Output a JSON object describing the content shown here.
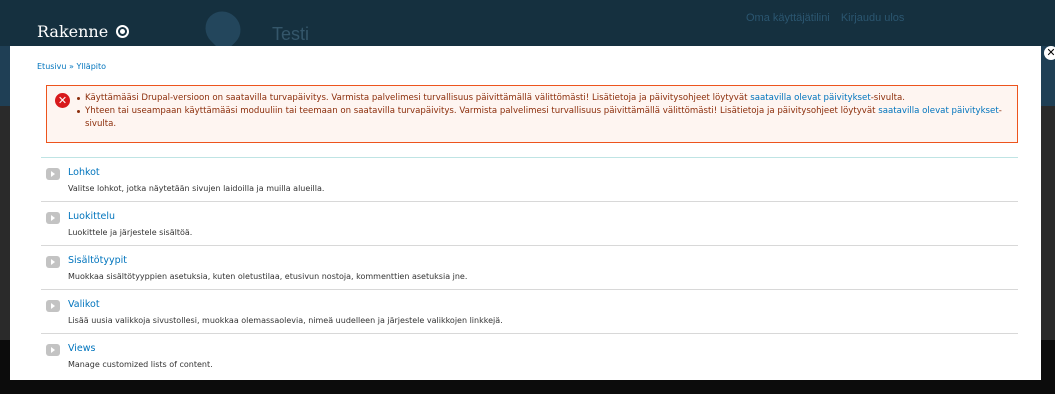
{
  "background": {
    "site_name": "Testi",
    "user_links": [
      "Oma käyttäjätilini",
      "Kirjaudu ulos"
    ]
  },
  "overlay": {
    "title": "Rakenne",
    "shortcut_icon": "add-shortcut-icon",
    "close_icon": "close-icon"
  },
  "breadcrumb": {
    "items": [
      "Etusivu",
      "Ylläpito"
    ],
    "separator": "»"
  },
  "messages": {
    "type": "error",
    "icon": "error-icon",
    "items": [
      {
        "text": "Käyttämääsi Drupal-versioon on saatavilla turvapäivitys. Varmista palvelimesi turvallisuus päivittämällä välittömästi! Lisätietoja ja päivitysohjeet löytyvät ",
        "link": "saatavilla olevat päivitykset",
        "suffix": "-sivulta."
      },
      {
        "text": "Yhteen tai useampaan käyttämääsi moduuliin tai teemaan on saatavilla turvapäivitys. Varmista palvelimesi turvallisuus päivittämällä välittömästi! Lisätietoja ja päivitysohjeet löytyvät ",
        "link": "saatavilla olevat päivitykset",
        "suffix": "-sivulta."
      }
    ]
  },
  "admin_list": [
    {
      "title": "Lohkot",
      "description": "Valitse lohkot, jotka näytetään sivujen laidoilla ja muilla alueilla."
    },
    {
      "title": "Luokittelu",
      "description": "Luokittele ja järjestele sisältöä."
    },
    {
      "title": "Sisältötyypit",
      "description": "Muokkaa sisältötyyppien asetuksia, kuten oletustilaa, etusivun nostoja, kommenttien asetuksia jne."
    },
    {
      "title": "Valikot",
      "description": "Lisää uusia valikkoja sivustollesi, muokkaa olemassaolevia, nimeä uudelleen ja järjestele valikkojen linkkejä."
    },
    {
      "title": "Views",
      "description": "Manage customized lists of content."
    }
  ],
  "colors": {
    "link": "#0074bd",
    "error_text": "#8c2e0b",
    "error_border": "#ed541d",
    "error_bg": "#fef5f1",
    "header_bg": "#15303f"
  }
}
